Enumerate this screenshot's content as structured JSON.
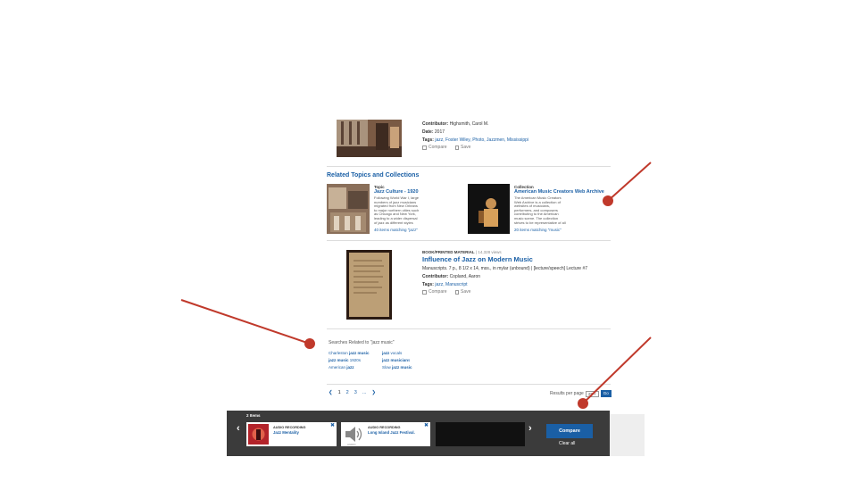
{
  "item1": {
    "contributor_label": "Contributor:",
    "contributor": "Highsmith, Carol M.",
    "date_label": "Date:",
    "date": "2017",
    "tags_label": "Tags:",
    "tags": "jazz, Foster Wiley, Photo, Jazzmen, Mississippi",
    "compare_label": "Compare",
    "save_label": "Save"
  },
  "related": {
    "heading": "Related Topics and Collections",
    "card1": {
      "kicker": "Topic",
      "title": "Jazz Culture - 1920",
      "desc": "Following World War I, large numbers of jazz musicians migrated from New Orleans to major northern cities such as Chicago and New York, leading to a wider dispersal of jazz as different styles developed in different cities.",
      "link": "40 items matching \"jazz\""
    },
    "card2": {
      "kicker": "Collection",
      "title": "American Music Creators Web Archive",
      "desc": "The American Music Creators Web Archive is a collection of websites of musicians, performers, and composers contributing to the American music scene. The collection strives to be representative of all genres of...",
      "link": "20 items matching \"music\""
    }
  },
  "item2": {
    "format": "BOOK/PRINTED MATERIAL",
    "views": "| 14,328 views",
    "title": "Influence of Jazz on Modern Music",
    "description": "Manuscripts. 7 p., 8 1/2 x 14, mss., in mylar (unbound) | [lecture/speech] Lecture #7",
    "contributor_label": "Contributor:",
    "contributor": "Copland, Aaron",
    "tags_label": "Tags:",
    "tags": "jazz, Manuscript",
    "compare_label": "Compare",
    "save_label": "Save"
  },
  "searches": {
    "heading": "Searches Related to \"jazz music\"",
    "links": [
      {
        "pre": "Charleston ",
        "bold": "jazz music",
        "post": ""
      },
      {
        "pre": "",
        "bold": "jazz",
        "post": " vocals"
      },
      {
        "pre": "",
        "bold": "jazz music",
        "post": " 1920s"
      },
      {
        "pre": "",
        "bold": "jazz musician",
        "post": "s"
      },
      {
        "pre": "American ",
        "bold": "jazz",
        "post": ""
      },
      {
        "pre": "Slow ",
        "bold": "jazz music",
        "post": ""
      }
    ]
  },
  "pagination": {
    "prev": "❮",
    "pages": [
      "1",
      "2",
      "3"
    ],
    "ellipsis": "...",
    "next": "❯",
    "rpp_label": "Results per page",
    "rpp_value": "25",
    "go_label": "Go"
  },
  "tray": {
    "count": "2 Items",
    "prev_arrow": "‹",
    "next_arrow": "›",
    "cards": [
      {
        "type": "AUDIO RECORDING",
        "title": "Jazz Mentality",
        "close": "✖",
        "icon": "album-art"
      },
      {
        "type": "AUDIO RECORDING",
        "title": "Long Island Jazz Festival.",
        "close": "✖",
        "icon": "speaker-icon",
        "icon_caption": "AUDIO"
      }
    ],
    "compare_label": "Compare",
    "clear_label": "Clear all"
  },
  "colors": {
    "link": "#1a5fa5",
    "tray_bg": "#3b3b3b",
    "annotation": "#c0392b"
  }
}
